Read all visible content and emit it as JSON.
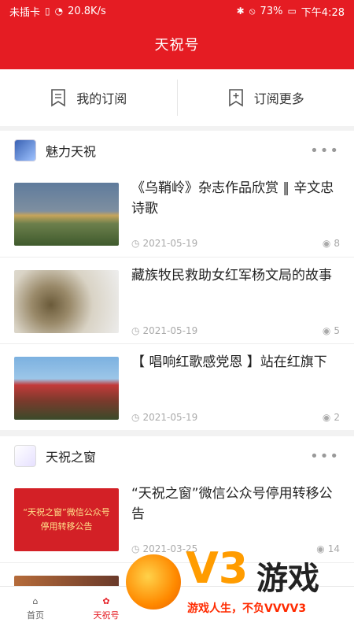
{
  "status": {
    "carrier": "未插卡",
    "speed": "20.8K/s",
    "battery": "73%",
    "time": "下午4:28"
  },
  "header": {
    "title": "天祝号"
  },
  "subscriptions": {
    "mine_label": "我的订阅",
    "more_label": "订阅更多"
  },
  "sections": [
    {
      "title": "魅力天祝",
      "articles": [
        {
          "title": "《乌鞘岭》杂志作品欣赏 ‖ 辛文忠诗歌",
          "date": "2021-05-19",
          "views": "8"
        },
        {
          "title": "藏族牧民救助女红军杨文局的故事",
          "date": "2021-05-19",
          "views": "5"
        },
        {
          "title": "【 唱响红歌感党恩 】站在红旗下",
          "date": "2021-05-19",
          "views": "2"
        }
      ]
    },
    {
      "title": "天祝之窗",
      "articles": [
        {
          "title": "“天祝之窗”微信公众号停用转移公告",
          "date": "2021-03-25",
          "views": "14",
          "thumb_line1": "“天祝之窗”微信公众号",
          "thumb_line2": "停用转移公告"
        }
      ]
    }
  ],
  "nav": {
    "home": "首页",
    "tianzhu": "天祝号"
  },
  "watermark": {
    "brand": "V3",
    "game": "游戏",
    "slogan": "游戏人生，不负VVVV3"
  },
  "colors": {
    "accent": "#e51c23",
    "watermark_orange": "#ff9c00"
  },
  "icons": [
    "bookmark-list-icon",
    "bookmark-add-icon",
    "clock-icon",
    "eye-icon",
    "more-icon",
    "home-icon",
    "tianzhu-icon"
  ]
}
